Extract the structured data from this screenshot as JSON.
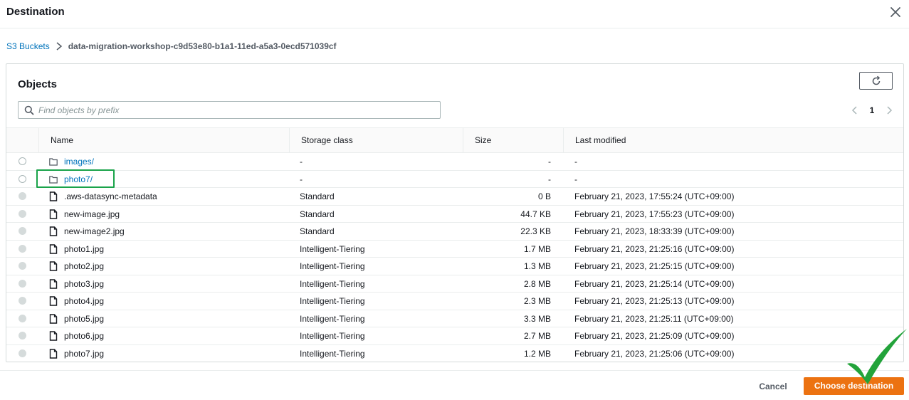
{
  "dialog": {
    "title": "Destination",
    "close_icon": "close-icon"
  },
  "breadcrumb": {
    "root": "S3 Buckets",
    "current": "data-migration-workshop-c9d53e80-b1a1-11ed-a5a3-0ecd571039cf"
  },
  "objects": {
    "title": "Objects",
    "search_placeholder": "Find objects by prefix",
    "page_number": "1",
    "columns": [
      "Name",
      "Storage class",
      "Size",
      "Last modified"
    ],
    "rows": [
      {
        "type": "folder",
        "name": "images/",
        "storage": "-",
        "size": "-",
        "modified": "-"
      },
      {
        "type": "folder",
        "name": "photo7/",
        "storage": "-",
        "size": "-",
        "modified": "-"
      },
      {
        "type": "file",
        "name": ".aws-datasync-metadata",
        "storage": "Standard",
        "size": "0 B",
        "modified": "February 21, 2023, 17:55:24 (UTC+09:00)"
      },
      {
        "type": "file",
        "name": "new-image.jpg",
        "storage": "Standard",
        "size": "44.7 KB",
        "modified": "February 21, 2023, 17:55:23 (UTC+09:00)"
      },
      {
        "type": "file",
        "name": "new-image2.jpg",
        "storage": "Standard",
        "size": "22.3 KB",
        "modified": "February 21, 2023, 18:33:39 (UTC+09:00)"
      },
      {
        "type": "file",
        "name": "photo1.jpg",
        "storage": "Intelligent-Tiering",
        "size": "1.7 MB",
        "modified": "February 21, 2023, 21:25:16 (UTC+09:00)"
      },
      {
        "type": "file",
        "name": "photo2.jpg",
        "storage": "Intelligent-Tiering",
        "size": "1.3 MB",
        "modified": "February 21, 2023, 21:25:15 (UTC+09:00)"
      },
      {
        "type": "file",
        "name": "photo3.jpg",
        "storage": "Intelligent-Tiering",
        "size": "2.8 MB",
        "modified": "February 21, 2023, 21:25:14 (UTC+09:00)"
      },
      {
        "type": "file",
        "name": "photo4.jpg",
        "storage": "Intelligent-Tiering",
        "size": "2.3 MB",
        "modified": "February 21, 2023, 21:25:13 (UTC+09:00)"
      },
      {
        "type": "file",
        "name": "photo5.jpg",
        "storage": "Intelligent-Tiering",
        "size": "3.3 MB",
        "modified": "February 21, 2023, 21:25:11 (UTC+09:00)"
      },
      {
        "type": "file",
        "name": "photo6.jpg",
        "storage": "Intelligent-Tiering",
        "size": "2.7 MB",
        "modified": "February 21, 2023, 21:25:09 (UTC+09:00)"
      },
      {
        "type": "file",
        "name": "photo7.jpg",
        "storage": "Intelligent-Tiering",
        "size": "1.2 MB",
        "modified": "February 21, 2023, 21:25:06 (UTC+09:00)"
      }
    ]
  },
  "footer": {
    "cancel_label": "Cancel",
    "choose_label": "Choose destination"
  },
  "colors": {
    "link": "#0073bb",
    "primary_button": "#ec7211",
    "highlight": "#1aa34a",
    "checkmark": "#22a33a"
  }
}
